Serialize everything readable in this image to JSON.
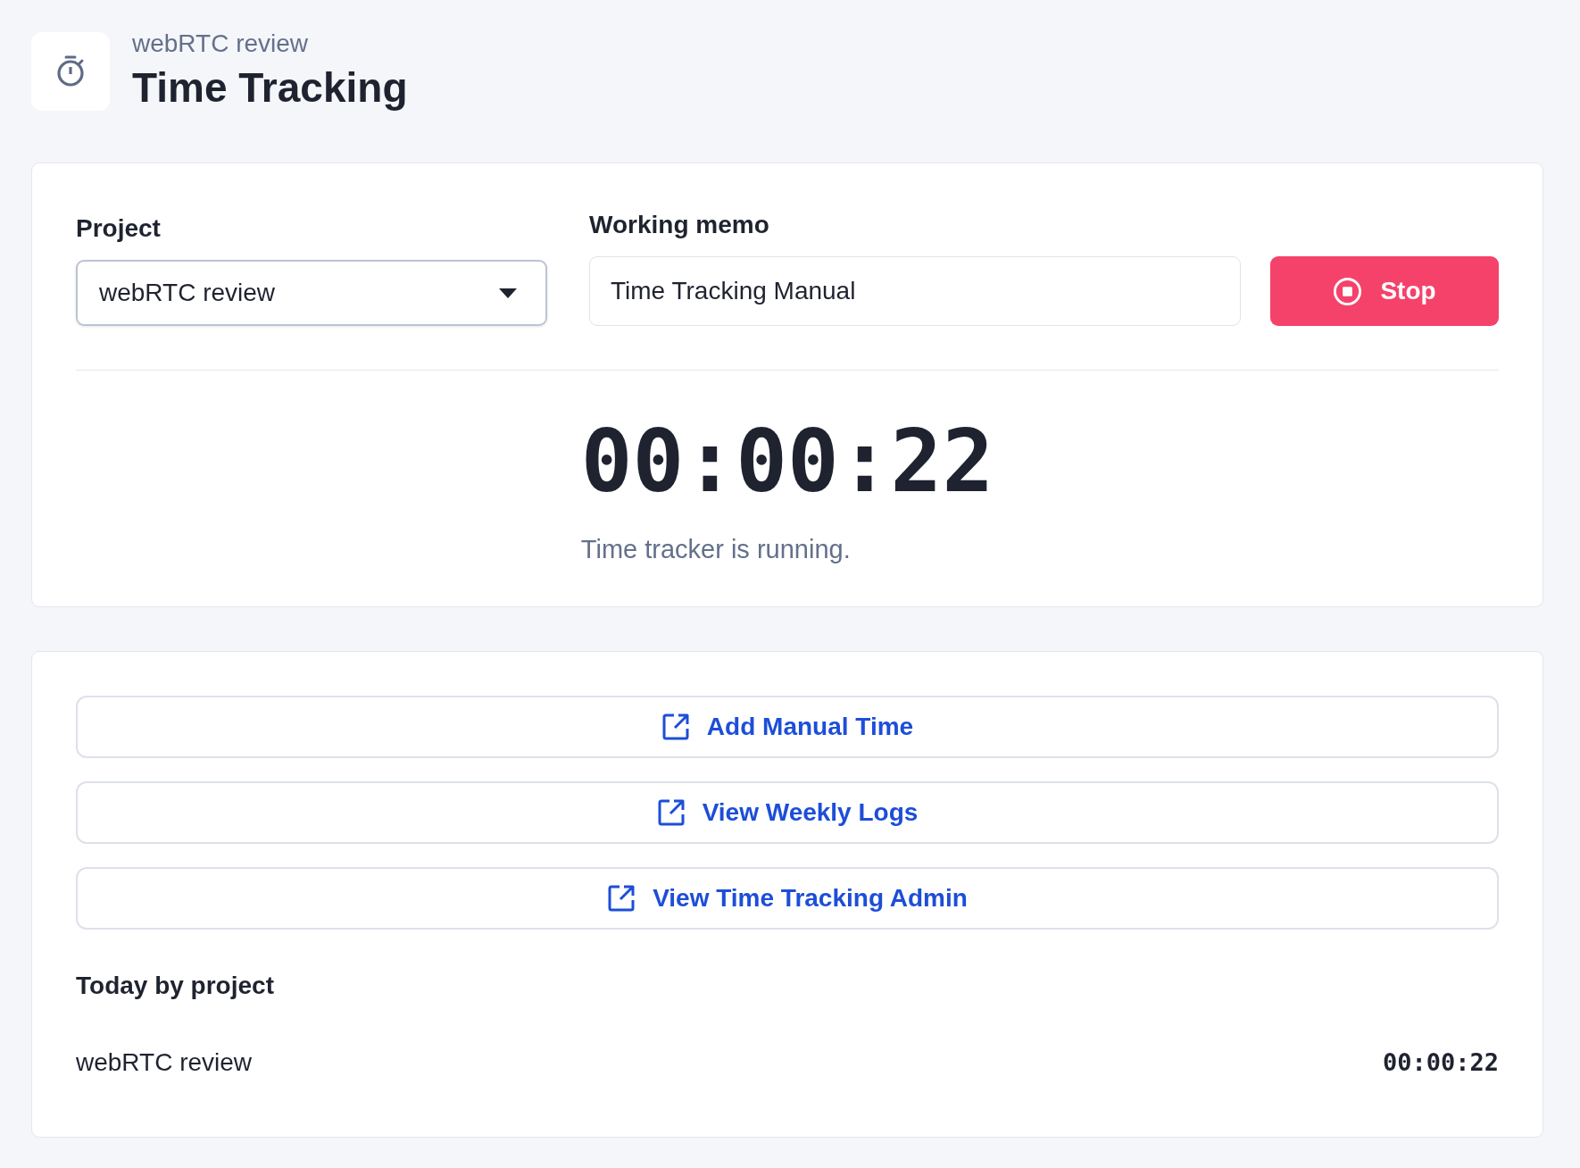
{
  "header": {
    "subtitle": "webRTC review",
    "title": "Time Tracking"
  },
  "tracker": {
    "project": {
      "label": "Project",
      "value": "webRTC review"
    },
    "memo": {
      "label": "Working memo",
      "value": "Time Tracking Manual"
    },
    "stop_button": "Stop",
    "timer": "00:00:22",
    "status": "Time tracker is running."
  },
  "links": [
    {
      "label": "Add Manual Time"
    },
    {
      "label": "View Weekly Logs"
    },
    {
      "label": "View Time Tracking Admin"
    }
  ],
  "today": {
    "title": "Today by project",
    "rows": [
      {
        "project": "webRTC review",
        "time": "00:00:22"
      }
    ]
  }
}
